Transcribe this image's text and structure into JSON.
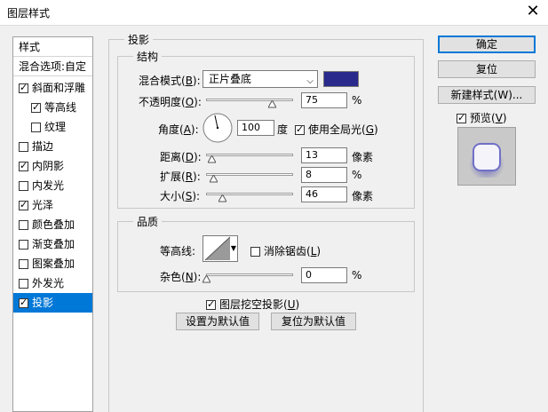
{
  "window": {
    "title": "图层样式",
    "close_glyph": "✕"
  },
  "sidebar": {
    "header": "样式",
    "blend_options": "混合选项:自定",
    "items": [
      {
        "label": "斜面和浮雕",
        "checked": true
      },
      {
        "label": "等高线",
        "checked": true
      },
      {
        "label": "纹理",
        "checked": false
      },
      {
        "label": "描边",
        "checked": false
      },
      {
        "label": "内阴影",
        "checked": true
      },
      {
        "label": "内发光",
        "checked": false
      },
      {
        "label": "光泽",
        "checked": true
      },
      {
        "label": "颜色叠加",
        "checked": false
      },
      {
        "label": "渐变叠加",
        "checked": false
      },
      {
        "label": "图案叠加",
        "checked": false
      },
      {
        "label": "外发光",
        "checked": false
      },
      {
        "label": "投影",
        "checked": true,
        "selected": true
      }
    ]
  },
  "panel": {
    "title": "投影",
    "structure": {
      "title": "结构",
      "blend_mode_label": "混合模式(",
      "blend_mode_key": "B",
      "blend_mode_suffix": "):",
      "blend_mode_value": "正片叠底",
      "blend_color": "#2a2a8c",
      "opacity_label": "不透明度(",
      "opacity_key": "O",
      "opacity_suffix": "):",
      "opacity_value": "75",
      "opacity_unit": "%",
      "opacity_fraction": 0.75,
      "angle_label": "角度(",
      "angle_key": "A",
      "angle_suffix": "):",
      "angle_value": "100",
      "angle_unit": "度",
      "global_light_label": "使用全局光(",
      "global_light_key": "G",
      "global_light_suffix": ")",
      "global_light_checked": true,
      "distance_label": "距离(",
      "distance_key": "D",
      "distance_suffix": "):",
      "distance_value": "13",
      "distance_unit": "像素",
      "distance_fraction": 0.06,
      "spread_label": "扩展(",
      "spread_key": "R",
      "spread_suffix": "):",
      "spread_value": "8",
      "spread_unit": "%",
      "spread_fraction": 0.08,
      "size_label": "大小(",
      "size_key": "S",
      "size_suffix": "):",
      "size_value": "46",
      "size_unit": "像素",
      "size_fraction": 0.18
    },
    "quality": {
      "title": "品质",
      "contour_label": "等高线:",
      "antialias_label": "消除锯齿(",
      "antialias_key": "L",
      "antialias_suffix": ")",
      "antialias_checked": false,
      "noise_label": "杂色(",
      "noise_key": "N",
      "noise_suffix": "):",
      "noise_value": "0",
      "noise_unit": "%",
      "noise_fraction": 0.0
    },
    "knockout_label": "图层挖空投影(",
    "knockout_key": "U",
    "knockout_suffix": ")",
    "knockout_checked": true,
    "set_default": "设置为默认值",
    "reset_default": "复位为默认值"
  },
  "buttons": {
    "ok": "确定",
    "reset": "复位",
    "new_style": "新建样式(W)...",
    "preview_label": "预览(",
    "preview_key": "V",
    "preview_suffix": ")",
    "preview_checked": true
  }
}
